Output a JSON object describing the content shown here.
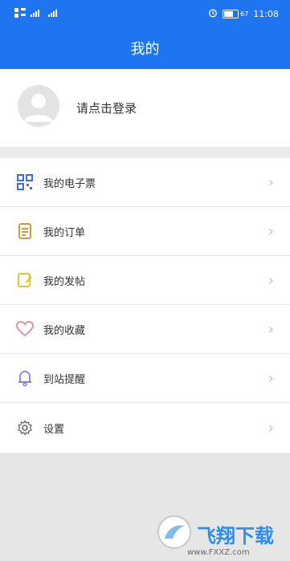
{
  "status_bar": {
    "time": "11:08",
    "battery": "67"
  },
  "header": {
    "title": "我的"
  },
  "profile": {
    "login_prompt": "请点击登录"
  },
  "menu": [
    {
      "label": "我的电子票",
      "icon": "qr-code-icon"
    },
    {
      "label": "我的订单",
      "icon": "order-icon"
    },
    {
      "label": "我的发帖",
      "icon": "post-icon"
    },
    {
      "label": "我的收藏",
      "icon": "heart-icon"
    },
    {
      "label": "到站提醒",
      "icon": "bell-icon"
    },
    {
      "label": "设置",
      "icon": "gear-icon"
    }
  ],
  "watermark": {
    "brand": "飞翔下载",
    "url": "www.FXXZ.com"
  },
  "colors": {
    "primary": "#1f74f0",
    "qr": "#3b6fd8",
    "order": "#d29a3a",
    "post": "#e7c233",
    "heart": "#e08a8a",
    "bell": "#8f7bd9",
    "gear": "#666666"
  }
}
